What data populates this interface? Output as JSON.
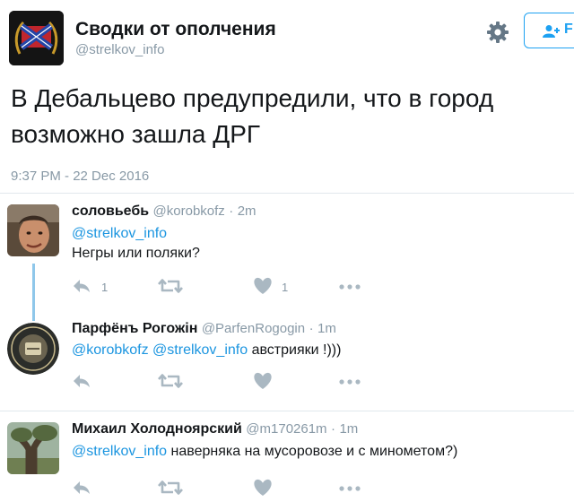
{
  "header": {
    "name": "Сводки от ополчения",
    "handle": "@strelkov_info",
    "follow_label": "F"
  },
  "tweet": {
    "text": "В Дебальцево предупредили, что в город возможно зашла ДРГ",
    "timestamp": "9:37 PM - 22 Dec 2016"
  },
  "replies": [
    {
      "name": "соловьебь",
      "handle": "@korobkofz",
      "time": "2m",
      "mentions": "@strelkov_info",
      "text": "Негры или поляки?",
      "reply_count": "1",
      "like_count": "1"
    },
    {
      "name": "Парфёнъ Рогожiн",
      "handle": "@ParfenRogogin",
      "time": "1m",
      "mentions": "@korobkofz @strelkov_info",
      "text": "австрияки !)))",
      "reply_count": "",
      "like_count": ""
    },
    {
      "name": "Михаил Холодноярский",
      "handle": "@m170261m",
      "time": "1m",
      "mentions": "@strelkov_info",
      "text": "наверняка на мусоровозе и с минометом?)",
      "reply_count": "",
      "like_count": ""
    }
  ],
  "separator": "·",
  "colors": {
    "accent": "#1da1f2",
    "mention": "#1b95e0",
    "muted": "#8899a6",
    "action": "#aab8c2",
    "thread_line": "#8fc7ea"
  },
  "icons": [
    "reply-icon",
    "retweet-icon",
    "heart-icon",
    "more-icon",
    "gear-icon",
    "follow-person-icon"
  ]
}
